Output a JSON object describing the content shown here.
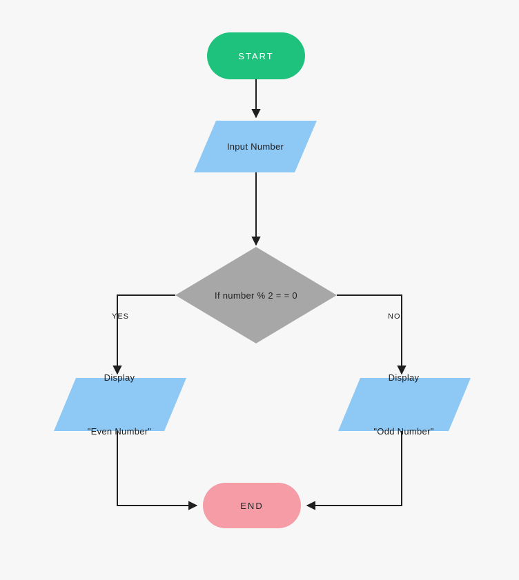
{
  "flowchart": {
    "start": "START",
    "input": "Input Number",
    "decision": "If number % 2 = = 0",
    "yes_label": "YES",
    "no_label": "NO",
    "display_even_line1": "Display",
    "display_even_line2": "\"Even Number\"",
    "display_odd_line1": "Display",
    "display_odd_line2": "\"Odd Number\"",
    "end": "END",
    "colors": {
      "start_fill": "#1ec27d",
      "end_fill": "#f59ca7",
      "io_fill": "#8ec8f5",
      "decision_fill": "#a7a7a7",
      "stroke": "#1f1f1f"
    }
  }
}
